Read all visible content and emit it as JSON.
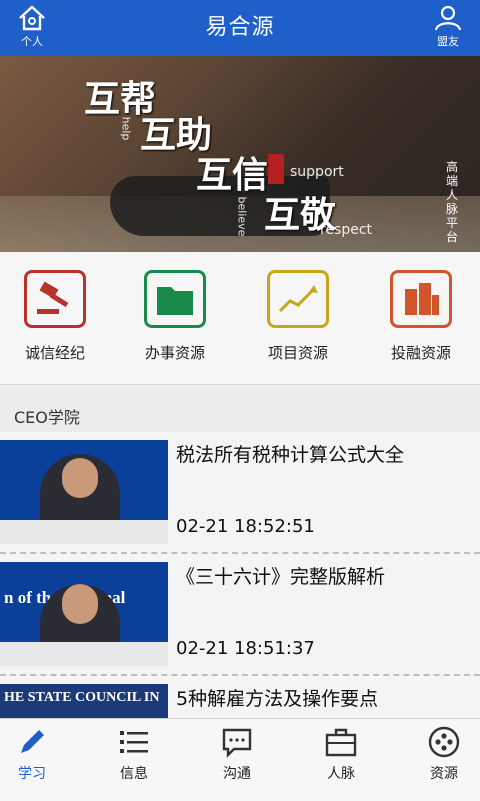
{
  "header": {
    "title": "易合源",
    "left_label": "个人",
    "right_label": "盟友"
  },
  "banner": {
    "words": [
      "互帮",
      "互助",
      "互信",
      "互敬"
    ],
    "english": [
      "help",
      "support",
      "believe",
      "respect"
    ],
    "vertical_text": "高端人脉平台",
    "slide_count": 5,
    "active_slide": 1
  },
  "categories": [
    {
      "label": "诚信经纪",
      "icon": "gavel-icon",
      "color": "#b5332a"
    },
    {
      "label": "办事资源",
      "icon": "folder-icon",
      "color": "#1a8a4a"
    },
    {
      "label": "项目资源",
      "icon": "trend-icon",
      "color": "#c9a51a"
    },
    {
      "label": "投融资源",
      "icon": "buildings-icon",
      "color": "#d0552a"
    }
  ],
  "section": {
    "title": "CEO学院"
  },
  "articles": [
    {
      "title": "税法所有税种计算公式大全",
      "time": "02-21 18:52:51",
      "thumb_caption": ""
    },
    {
      "title": "《三十六计》完整版解析",
      "time": "02-21 18:51:37",
      "thumb_caption": "n of the National"
    },
    {
      "title": "5种解雇方法及操作要点",
      "time": "",
      "thumb_caption": "HE STATE COUNCIL IN"
    }
  ],
  "tabs": [
    {
      "label": "学习",
      "icon": "pen-icon",
      "active": true
    },
    {
      "label": "信息",
      "icon": "list-icon",
      "active": false
    },
    {
      "label": "沟通",
      "icon": "chat-icon",
      "active": false
    },
    {
      "label": "人脉",
      "icon": "briefcase-icon",
      "active": false
    },
    {
      "label": "资源",
      "icon": "resource-icon",
      "active": false
    }
  ],
  "colors": {
    "header_bg": "#1f5fc9",
    "active_tab": "#1f5fc9"
  }
}
